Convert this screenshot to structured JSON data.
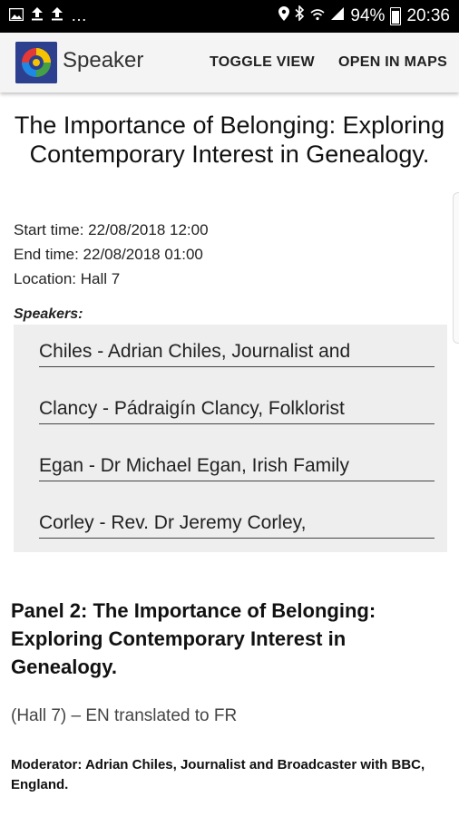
{
  "status_bar": {
    "left_icons": [
      "image-icon",
      "upload-icon",
      "upload-icon",
      "more-icon"
    ],
    "battery": "94%",
    "time": "20:36"
  },
  "app_bar": {
    "title": "Speaker",
    "actions": [
      "TOGGLE VIEW",
      "OPEN IN MAPS"
    ],
    "logo_colors": [
      "#2d3f8f",
      "#f5c400",
      "#e53935",
      "#43a047",
      "#1e88e5"
    ]
  },
  "session": {
    "title": "The Importance of Belonging: Exploring Contemporary Interest in Genealogy.",
    "start_time": "Start time: 22/08/2018 12:00",
    "end_time": "End time: 22/08/2018 01:00",
    "location": "Location: Hall 7",
    "speakers_label": "Speakers:",
    "speakers": [
      "Chiles - Adrian Chiles, Journalist and",
      "Clancy - Pádraigín Clancy, Folklorist",
      "Egan - Dr Michael Egan, Irish Family",
      "Corley - Rev. Dr Jeremy Corley,"
    ]
  },
  "panel": {
    "title": "Panel 2: The Importance of Belonging: Exploring Contemporary Interest in Genealogy.",
    "location": "(Hall 7) – EN translated to FR",
    "moderator": "Moderator: Adrian Chiles, Journalist and Broadcaster with BBC, England."
  }
}
